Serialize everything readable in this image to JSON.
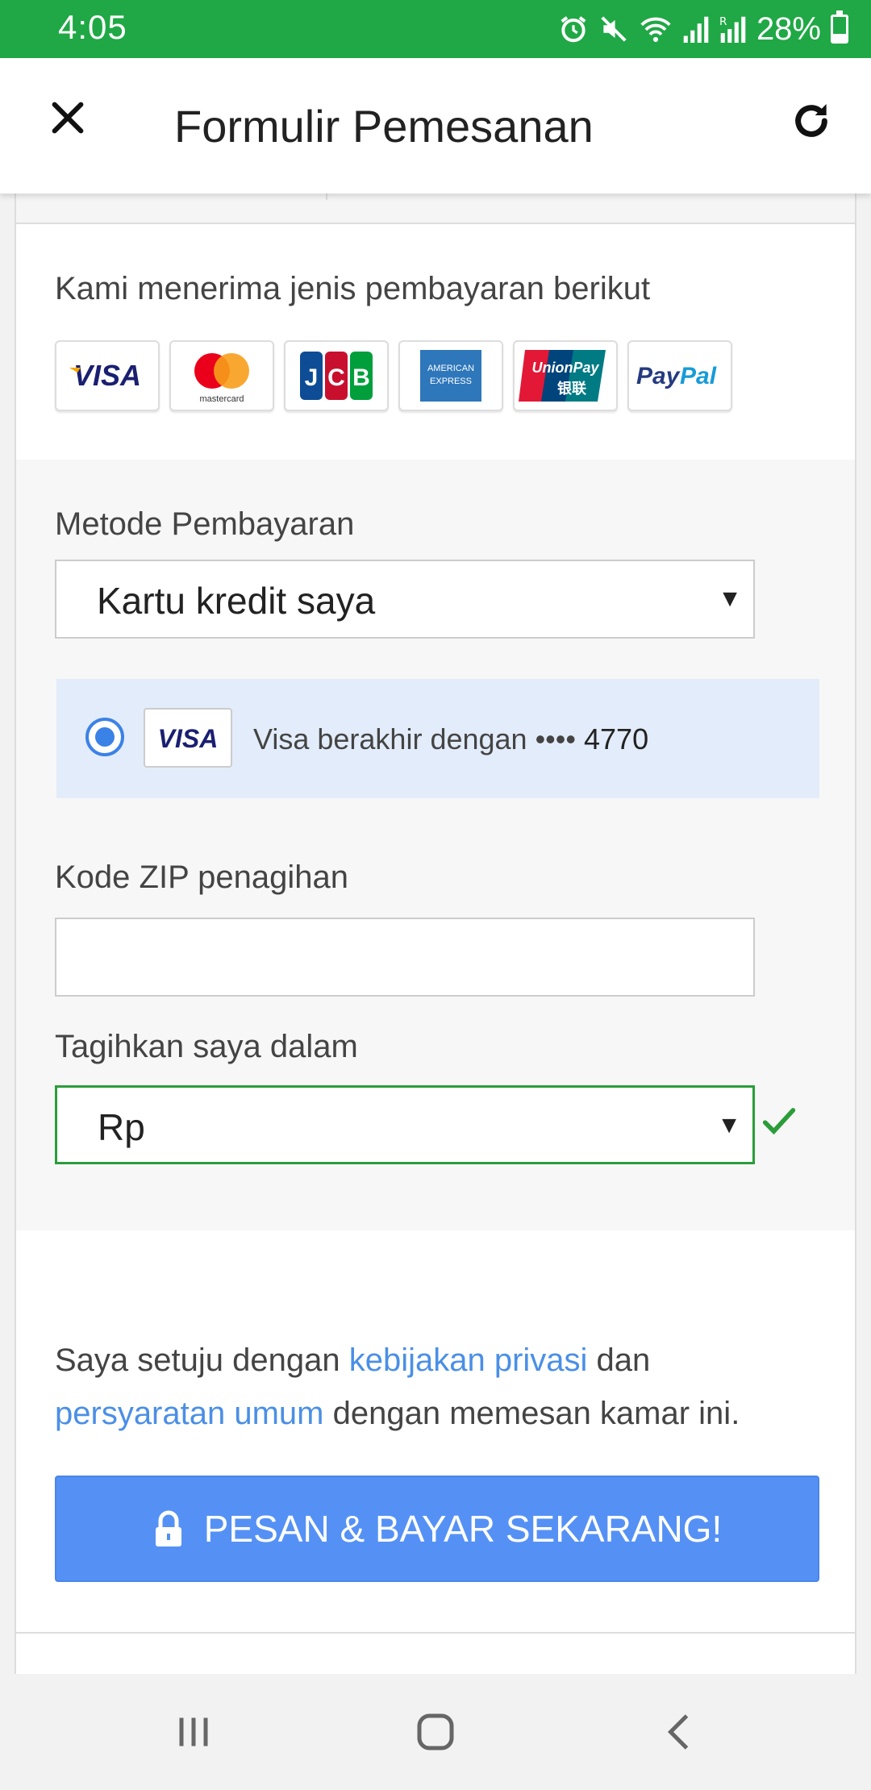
{
  "status_bar": {
    "time": "4:05",
    "battery": "28%",
    "icons": [
      "alarm-icon",
      "mute-icon",
      "wifi-icon",
      "signal-icon",
      "signal-r-icon",
      "battery-icon"
    ]
  },
  "header": {
    "title": "Formulir Pemesanan",
    "close_icon": "close-icon",
    "refresh_icon": "refresh-icon"
  },
  "payment": {
    "accepted_label": "Kami menerima jenis pembayaran berikut",
    "card_types": [
      "VISA",
      "mastercard",
      "JCB",
      "AMERICAN EXPRESS",
      "UnionPay 银联",
      "PayPal"
    ],
    "method_label": "Metode Pembayaran",
    "method_value": "Kartu kredit saya",
    "saved_card_text": "Visa berakhir dengan ••••",
    "saved_card_last4": "4770",
    "saved_card_brand": "VISA",
    "zip_label": "Kode ZIP penagihan",
    "zip_value": "",
    "currency_label": "Tagihkan saya dalam",
    "currency_value": "Rp"
  },
  "agreement": {
    "pre": "Saya setuju dengan ",
    "link1": "kebijakan privasi",
    "mid": " dan",
    "link2": "persyaratan umum",
    "post": " dengan memesan kamar ini."
  },
  "book_button": {
    "label": "PESAN & BAYAR SEKARANG!",
    "icon": "lock-icon"
  },
  "colors": {
    "status_bar": "#1fa845",
    "link": "#4a8fe6",
    "button": "#5591f5",
    "selected_card_bg": "#e3ecfa",
    "valid_green": "#2a9d3a"
  },
  "nav": [
    "recent-apps-icon",
    "home-icon",
    "back-icon"
  ]
}
